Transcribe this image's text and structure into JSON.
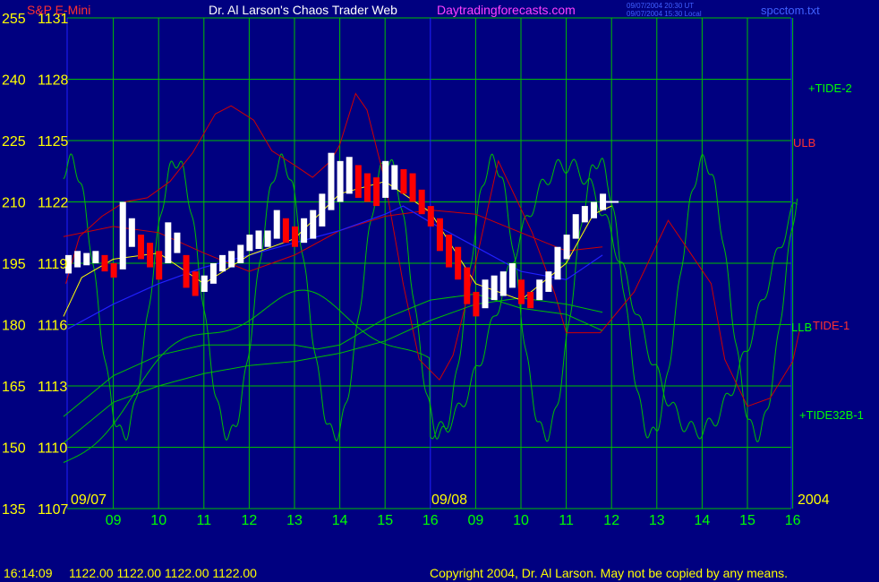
{
  "header": {
    "symbol": "S&P E-Mini",
    "title": "Dr. Al Larson's Chaos Trader Web",
    "site": "Daytradingforecasts.com",
    "stamp_ut": "09/07/2004 20:30 UT",
    "stamp_local": "09/07/2004 15:30 Local",
    "file": "spcctom.txt"
  },
  "footer": {
    "time": "16:14:09",
    "ohlc": "1122.00 1122.00 1122.00 1122.00",
    "copyright": "Copyright 2004, Dr. Al Larson. May not be copied by any means."
  },
  "colors": {
    "background": "#000080",
    "grid": "#00c000",
    "axis_text": "#ffff00",
    "hour_labels": "#00ff00",
    "price_up": "#ffffff",
    "price_down": "#ff0000",
    "tide_green": "#00c000",
    "tide_red": "#d00000",
    "trend_blue": "#2020ff",
    "average": "#ffff00",
    "magenta": "#ff40ff"
  },
  "chart_data": {
    "type": "line",
    "x_labels": [
      "09",
      "10",
      "11",
      "12",
      "13",
      "14",
      "15",
      "16",
      "09",
      "10",
      "11",
      "12",
      "13",
      "14",
      "15",
      "16"
    ],
    "date_labels": [
      "09/07",
      "09/08",
      "2004"
    ],
    "y_left_ticks": [
      "135",
      "150",
      "165",
      "180",
      "195",
      "210",
      "225",
      "240",
      "255"
    ],
    "y_price_ticks": [
      "1107",
      "1110",
      "1113",
      "1116",
      "1119",
      "1122",
      "1125",
      "1128",
      "1131"
    ],
    "ylim": [
      1107,
      1131
    ],
    "series_labels": [
      "+TIDE-2",
      "ULB",
      "LLB",
      "TIDE-1",
      "+TIDE32B-1"
    ],
    "last_price": 1122.0,
    "price_bars": [
      [
        0,
        1118.5,
        1119.4
      ],
      [
        0.2,
        1118.8,
        1119.6
      ],
      [
        0.4,
        1118.9,
        1119.5
      ],
      [
        0.6,
        1119.0,
        1119.6
      ],
      [
        0.8,
        1118.6,
        1119.4
      ],
      [
        1.0,
        1118.3,
        1119.0
      ],
      [
        1.2,
        1118.7,
        1122.0
      ],
      [
        1.4,
        1119.8,
        1121.2
      ],
      [
        1.6,
        1119.2,
        1120.4
      ],
      [
        1.8,
        1118.8,
        1120.0
      ],
      [
        2.0,
        1118.2,
        1119.6
      ],
      [
        2.2,
        1119.0,
        1121.0
      ],
      [
        2.4,
        1119.5,
        1120.5
      ],
      [
        2.6,
        1117.8,
        1119.4
      ],
      [
        2.8,
        1117.4,
        1118.6
      ],
      [
        3.0,
        1117.6,
        1118.4
      ],
      [
        3.2,
        1118.0,
        1119.0
      ],
      [
        3.4,
        1118.6,
        1119.4
      ],
      [
        3.6,
        1118.8,
        1119.6
      ],
      [
        3.8,
        1119.0,
        1119.9
      ],
      [
        4.0,
        1119.6,
        1120.4
      ],
      [
        4.2,
        1119.7,
        1120.6
      ],
      [
        4.4,
        1119.8,
        1120.6
      ],
      [
        4.6,
        1120.2,
        1121.6
      ],
      [
        4.8,
        1120.0,
        1121.2
      ],
      [
        5.0,
        1119.8,
        1120.8
      ],
      [
        5.2,
        1120.0,
        1121.2
      ],
      [
        5.4,
        1120.2,
        1121.6
      ],
      [
        5.6,
        1120.8,
        1122.4
      ],
      [
        5.8,
        1121.6,
        1124.4
      ],
      [
        6.0,
        1122.0,
        1124.0
      ],
      [
        6.2,
        1122.4,
        1124.2
      ],
      [
        6.4,
        1122.2,
        1123.8
      ],
      [
        6.6,
        1122.0,
        1123.4
      ],
      [
        6.8,
        1121.8,
        1123.2
      ],
      [
        7.0,
        1122.2,
        1124.0
      ],
      [
        7.2,
        1122.6,
        1123.8
      ],
      [
        7.4,
        1122.4,
        1123.6
      ],
      [
        7.6,
        1122.0,
        1123.4
      ],
      [
        7.8,
        1121.4,
        1122.6
      ],
      [
        8.0,
        1120.8,
        1121.8
      ],
      [
        8.2,
        1119.6,
        1121.2
      ],
      [
        8.4,
        1118.8,
        1120.4
      ],
      [
        8.6,
        1118.2,
        1119.8
      ],
      [
        8.8,
        1117.0,
        1118.8
      ],
      [
        9.0,
        1116.4,
        1117.6
      ],
      [
        9.2,
        1116.8,
        1118.2
      ],
      [
        9.4,
        1117.2,
        1118.4
      ],
      [
        9.6,
        1117.4,
        1118.6
      ],
      [
        9.8,
        1117.8,
        1119.0
      ],
      [
        10.0,
        1117.0,
        1118.2
      ],
      [
        10.2,
        1116.8,
        1117.6
      ],
      [
        10.4,
        1117.2,
        1118.2
      ],
      [
        10.6,
        1117.6,
        1118.6
      ],
      [
        10.8,
        1118.2,
        1119.8
      ],
      [
        11.0,
        1119.2,
        1120.4
      ],
      [
        11.2,
        1120.2,
        1121.4
      ],
      [
        11.4,
        1121.0,
        1121.8
      ],
      [
        11.6,
        1121.2,
        1122.0
      ],
      [
        11.8,
        1121.6,
        1122.4
      ]
    ]
  }
}
